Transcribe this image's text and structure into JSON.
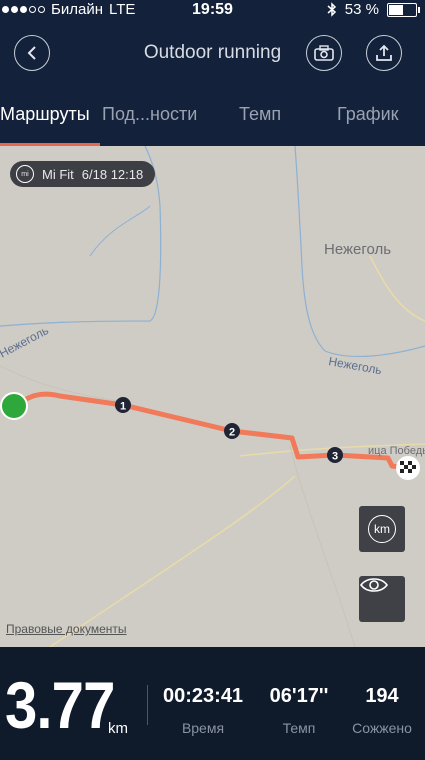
{
  "status_bar": {
    "carrier": "Билайн",
    "network": "LTE",
    "time": "19:59",
    "battery": "53 %",
    "battery_level": 0.53
  },
  "nav": {
    "title": "Outdoor running",
    "back_icon": "chevron-left-icon",
    "camera_icon": "camera-icon",
    "share_icon": "upload-icon"
  },
  "tabs": [
    {
      "label": "Маршруты",
      "active": true
    },
    {
      "label": "Под...ности",
      "active": false
    },
    {
      "label": "Темп",
      "active": false
    },
    {
      "label": "График",
      "active": false
    }
  ],
  "map": {
    "badge": {
      "source": "Mi Fit",
      "datetime": "6/18 12:18"
    },
    "places": {
      "village": "Нежеголь",
      "river_west": "Нежеголь",
      "river_east": "Нежеголь",
      "street": "ица Победы"
    },
    "km_markers": [
      "1",
      "2",
      "3"
    ],
    "km_button": "km",
    "legal_link": "Правовые документы",
    "colors": {
      "route": "#f07a5a",
      "start": "#2ea83a",
      "background": "#cfccc5",
      "river": "#8db0d3",
      "road": "#e8dba9"
    }
  },
  "stats": {
    "distance": "3.77",
    "distance_unit": "km",
    "items": [
      {
        "value": "00:23:41",
        "label": "Время"
      },
      {
        "value": "06'17''",
        "label": "Темп"
      },
      {
        "value": "194",
        "label": "Сожжено"
      }
    ]
  }
}
